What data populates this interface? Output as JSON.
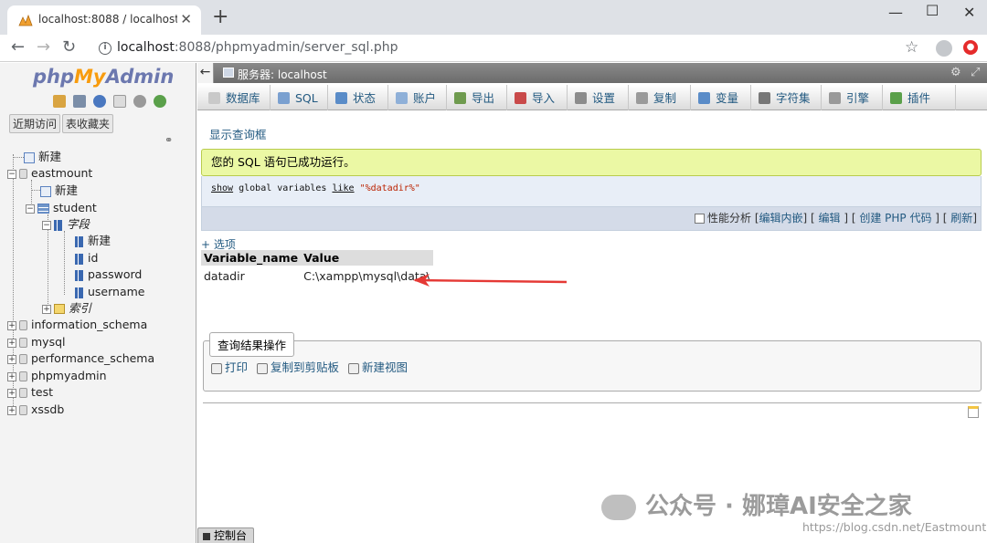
{
  "browser": {
    "tab_title": "localhost:8088 / localhost | ph",
    "url_host": "localhost",
    "url_path": ":8088/phpmyadmin/server_sql.php"
  },
  "sidebar": {
    "logo_php": "php",
    "logo_my": "My",
    "logo_admin": "Admin",
    "recent": "近期访问",
    "favorites": "表收藏夹",
    "tree": {
      "new_root": "新建",
      "eastmount": "eastmount",
      "new_db": "新建",
      "student": "student",
      "fields": "字段",
      "new_col": "新建",
      "col_id": "id",
      "col_password": "password",
      "col_username": "username",
      "indexes": "索引",
      "information_schema": "information_schema",
      "mysql": "mysql",
      "performance_schema": "performance_schema",
      "phpmyadmin": "phpmyadmin",
      "test": "test",
      "xssdb": "xssdb"
    }
  },
  "main": {
    "server_label": "服务器: localhost",
    "menu": [
      {
        "label": "数据库",
        "color": "#c9c9c9"
      },
      {
        "label": "SQL",
        "color": "#7aa0d0"
      },
      {
        "label": "状态",
        "color": "#5a8cc8"
      },
      {
        "label": "账户",
        "color": "#8fb0d8"
      },
      {
        "label": "导出",
        "color": "#6f9b4f"
      },
      {
        "label": "导入",
        "color": "#c94a4a"
      },
      {
        "label": "设置",
        "color": "#8c8c8c"
      },
      {
        "label": "复制",
        "color": "#9a9a9a"
      },
      {
        "label": "变量",
        "color": "#5a8cc8"
      },
      {
        "label": "字符集",
        "color": "#777777"
      },
      {
        "label": "引擎",
        "color": "#999999"
      },
      {
        "label": "插件",
        "color": "#5aa04a"
      }
    ],
    "show_query_box": "显示查询框",
    "success_msg": "您的 SQL 语句已成功运行。",
    "sql": {
      "kw1": "show",
      "mid": " global variables ",
      "kw2": "like",
      "str": " \"%datadir%\""
    },
    "sqlbar": {
      "profiling": "性能分析",
      "edit_inline": "编辑内嵌",
      "edit": "编辑",
      "create_php": "创建 PHP 代码",
      "refresh": "刷新"
    },
    "options": "+ 选项",
    "table": {
      "headers": [
        "Variable_name",
        "Value"
      ],
      "rows": [
        [
          "datadir",
          "C:\\xampp\\mysql\\data\\"
        ]
      ]
    },
    "query_ops": {
      "legend": "查询结果操作",
      "print": "打印",
      "copy": "复制到剪贴板",
      "new_view": "新建视图"
    },
    "console": "控制台"
  },
  "watermark": {
    "text": "公众号 · 娜璋AI安全之家",
    "url": "https://blog.csdn.net/Eastmount"
  },
  "colors": {
    "accent": "#235a81",
    "success_bg": "#ebf8a4",
    "arrow": "#e53935"
  }
}
